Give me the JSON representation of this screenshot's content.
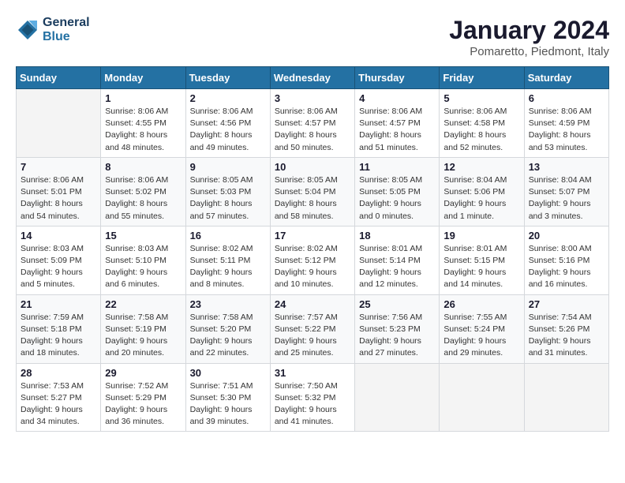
{
  "header": {
    "logo_line1": "General",
    "logo_line2": "Blue",
    "month_title": "January 2024",
    "subtitle": "Pomaretto, Piedmont, Italy"
  },
  "days_of_week": [
    "Sunday",
    "Monday",
    "Tuesday",
    "Wednesday",
    "Thursday",
    "Friday",
    "Saturday"
  ],
  "weeks": [
    [
      {
        "day": "",
        "info": ""
      },
      {
        "day": "1",
        "info": "Sunrise: 8:06 AM\nSunset: 4:55 PM\nDaylight: 8 hours\nand 48 minutes."
      },
      {
        "day": "2",
        "info": "Sunrise: 8:06 AM\nSunset: 4:56 PM\nDaylight: 8 hours\nand 49 minutes."
      },
      {
        "day": "3",
        "info": "Sunrise: 8:06 AM\nSunset: 4:57 PM\nDaylight: 8 hours\nand 50 minutes."
      },
      {
        "day": "4",
        "info": "Sunrise: 8:06 AM\nSunset: 4:57 PM\nDaylight: 8 hours\nand 51 minutes."
      },
      {
        "day": "5",
        "info": "Sunrise: 8:06 AM\nSunset: 4:58 PM\nDaylight: 8 hours\nand 52 minutes."
      },
      {
        "day": "6",
        "info": "Sunrise: 8:06 AM\nSunset: 4:59 PM\nDaylight: 8 hours\nand 53 minutes."
      }
    ],
    [
      {
        "day": "7",
        "info": "Sunrise: 8:06 AM\nSunset: 5:01 PM\nDaylight: 8 hours\nand 54 minutes."
      },
      {
        "day": "8",
        "info": "Sunrise: 8:06 AM\nSunset: 5:02 PM\nDaylight: 8 hours\nand 55 minutes."
      },
      {
        "day": "9",
        "info": "Sunrise: 8:05 AM\nSunset: 5:03 PM\nDaylight: 8 hours\nand 57 minutes."
      },
      {
        "day": "10",
        "info": "Sunrise: 8:05 AM\nSunset: 5:04 PM\nDaylight: 8 hours\nand 58 minutes."
      },
      {
        "day": "11",
        "info": "Sunrise: 8:05 AM\nSunset: 5:05 PM\nDaylight: 9 hours\nand 0 minutes."
      },
      {
        "day": "12",
        "info": "Sunrise: 8:04 AM\nSunset: 5:06 PM\nDaylight: 9 hours\nand 1 minute."
      },
      {
        "day": "13",
        "info": "Sunrise: 8:04 AM\nSunset: 5:07 PM\nDaylight: 9 hours\nand 3 minutes."
      }
    ],
    [
      {
        "day": "14",
        "info": "Sunrise: 8:03 AM\nSunset: 5:09 PM\nDaylight: 9 hours\nand 5 minutes."
      },
      {
        "day": "15",
        "info": "Sunrise: 8:03 AM\nSunset: 5:10 PM\nDaylight: 9 hours\nand 6 minutes."
      },
      {
        "day": "16",
        "info": "Sunrise: 8:02 AM\nSunset: 5:11 PM\nDaylight: 9 hours\nand 8 minutes."
      },
      {
        "day": "17",
        "info": "Sunrise: 8:02 AM\nSunset: 5:12 PM\nDaylight: 9 hours\nand 10 minutes."
      },
      {
        "day": "18",
        "info": "Sunrise: 8:01 AM\nSunset: 5:14 PM\nDaylight: 9 hours\nand 12 minutes."
      },
      {
        "day": "19",
        "info": "Sunrise: 8:01 AM\nSunset: 5:15 PM\nDaylight: 9 hours\nand 14 minutes."
      },
      {
        "day": "20",
        "info": "Sunrise: 8:00 AM\nSunset: 5:16 PM\nDaylight: 9 hours\nand 16 minutes."
      }
    ],
    [
      {
        "day": "21",
        "info": "Sunrise: 7:59 AM\nSunset: 5:18 PM\nDaylight: 9 hours\nand 18 minutes."
      },
      {
        "day": "22",
        "info": "Sunrise: 7:58 AM\nSunset: 5:19 PM\nDaylight: 9 hours\nand 20 minutes."
      },
      {
        "day": "23",
        "info": "Sunrise: 7:58 AM\nSunset: 5:20 PM\nDaylight: 9 hours\nand 22 minutes."
      },
      {
        "day": "24",
        "info": "Sunrise: 7:57 AM\nSunset: 5:22 PM\nDaylight: 9 hours\nand 25 minutes."
      },
      {
        "day": "25",
        "info": "Sunrise: 7:56 AM\nSunset: 5:23 PM\nDaylight: 9 hours\nand 27 minutes."
      },
      {
        "day": "26",
        "info": "Sunrise: 7:55 AM\nSunset: 5:24 PM\nDaylight: 9 hours\nand 29 minutes."
      },
      {
        "day": "27",
        "info": "Sunrise: 7:54 AM\nSunset: 5:26 PM\nDaylight: 9 hours\nand 31 minutes."
      }
    ],
    [
      {
        "day": "28",
        "info": "Sunrise: 7:53 AM\nSunset: 5:27 PM\nDaylight: 9 hours\nand 34 minutes."
      },
      {
        "day": "29",
        "info": "Sunrise: 7:52 AM\nSunset: 5:29 PM\nDaylight: 9 hours\nand 36 minutes."
      },
      {
        "day": "30",
        "info": "Sunrise: 7:51 AM\nSunset: 5:30 PM\nDaylight: 9 hours\nand 39 minutes."
      },
      {
        "day": "31",
        "info": "Sunrise: 7:50 AM\nSunset: 5:32 PM\nDaylight: 9 hours\nand 41 minutes."
      },
      {
        "day": "",
        "info": ""
      },
      {
        "day": "",
        "info": ""
      },
      {
        "day": "",
        "info": ""
      }
    ]
  ]
}
